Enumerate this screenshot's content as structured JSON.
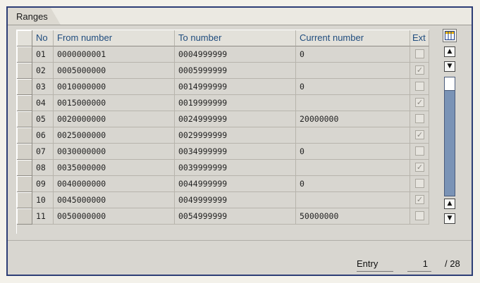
{
  "tab": {
    "label": "Ranges"
  },
  "columns": {
    "no": "No",
    "from": "From number",
    "to": "To number",
    "current": "Current number",
    "ext": "Ext"
  },
  "rows": [
    {
      "no": "01",
      "from": "0000000001",
      "to": "0004999999",
      "current": "0",
      "ext": false
    },
    {
      "no": "02",
      "from": "0005000000",
      "to": "0005999999",
      "current": "",
      "ext": true
    },
    {
      "no": "03",
      "from": "0010000000",
      "to": "0014999999",
      "current": "0",
      "ext": false
    },
    {
      "no": "04",
      "from": "0015000000",
      "to": "0019999999",
      "current": "",
      "ext": true
    },
    {
      "no": "05",
      "from": "0020000000",
      "to": "0024999999",
      "current": "20000000",
      "ext": false
    },
    {
      "no": "06",
      "from": "0025000000",
      "to": "0029999999",
      "current": "",
      "ext": true
    },
    {
      "no": "07",
      "from": "0030000000",
      "to": "0034999999",
      "current": "0",
      "ext": false
    },
    {
      "no": "08",
      "from": "0035000000",
      "to": "0039999999",
      "current": "",
      "ext": true
    },
    {
      "no": "09",
      "from": "0040000000",
      "to": "0044999999",
      "current": "0",
      "ext": false
    },
    {
      "no": "10",
      "from": "0045000000",
      "to": "0049999999",
      "current": "",
      "ext": true
    },
    {
      "no": "11",
      "from": "0050000000",
      "to": "0054999999",
      "current": "50000000",
      "ext": false
    }
  ],
  "scroll": {
    "up_glyph": "▲",
    "down_glyph": "▼"
  },
  "footer": {
    "entry_label": "Entry",
    "entry_value": "1",
    "entry_total": "/ 28"
  },
  "colors": {
    "frame": "#2d3e76",
    "header_text": "#1f4c7e",
    "scroll_track": "#7a93b6"
  },
  "icons": {
    "column_config": "table-settings-icon"
  }
}
